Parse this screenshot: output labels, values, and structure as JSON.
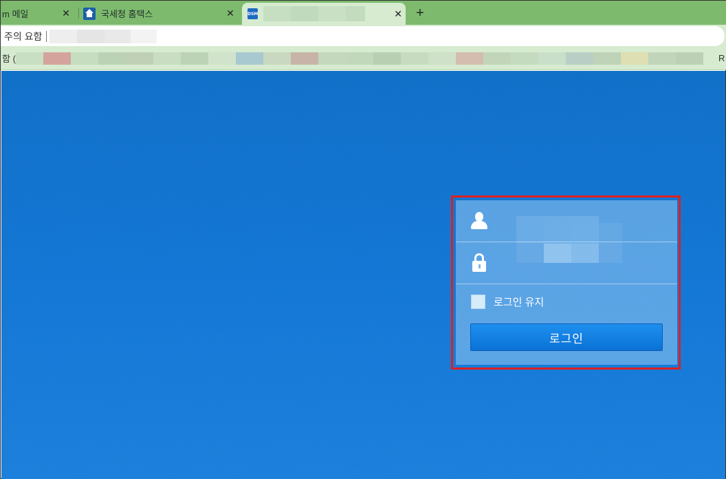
{
  "browser": {
    "tabs": [
      {
        "title": "m 메일",
        "close": "✕",
        "active": false
      },
      {
        "title": "국세청 홈택스",
        "close": "✕",
        "active": false
      },
      {
        "title": "",
        "close": "✕",
        "active": true,
        "favicon_text": "DSM"
      }
    ],
    "new_tab": "+",
    "address": {
      "security_text": "주의 요함",
      "url": ""
    },
    "bookmarks": {
      "left_text": "함 (",
      "right_text": "R"
    }
  },
  "login": {
    "username_placeholder": "",
    "password_placeholder": "",
    "remember_label": "로그인 유지",
    "remember_checked": false,
    "submit_label": "로그인"
  },
  "colors": {
    "tabstrip": "#7dba6e",
    "toolbar": "#d6ebcf",
    "page_bg": "#1377d6",
    "login_button": "#0b72d6",
    "highlight_border": "#e0201f"
  },
  "icons": [
    "hometax-favicon",
    "dsm-favicon",
    "user-icon",
    "lock-icon",
    "close-icon",
    "plus-icon"
  ]
}
